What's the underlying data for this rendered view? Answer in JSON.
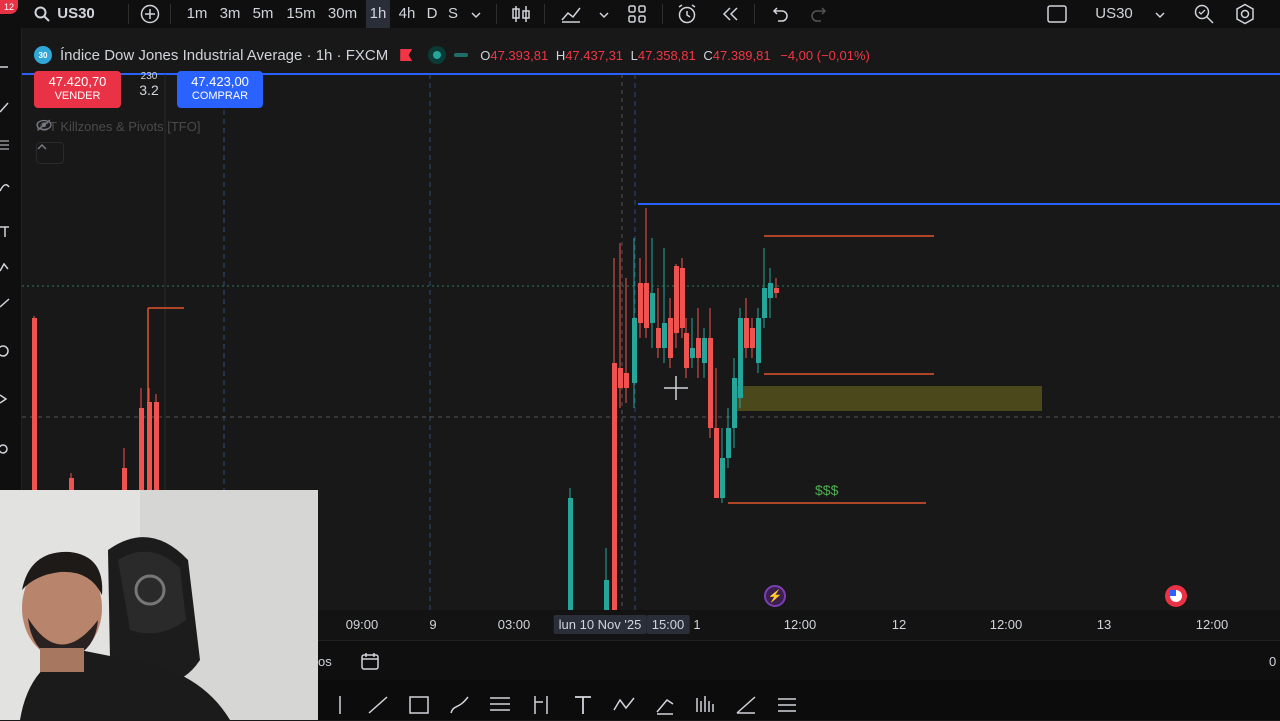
{
  "toolbar": {
    "symbol": "US30",
    "timeframes": [
      "1m",
      "3m",
      "5m",
      "15m",
      "30m",
      "1h",
      "4h",
      "D",
      "S"
    ],
    "active_timeframe": "1h",
    "right_symbol": "US30",
    "notification_count": "12"
  },
  "legend": {
    "symbol_badge": "30",
    "title": "Índice Dow Jones Industrial Average · 1h · FXCM",
    "open_label": "O",
    "open": "47.393,81",
    "high_label": "H",
    "high": "47.437,31",
    "low_label": "L",
    "low": "47.358,81",
    "close_label": "C",
    "close": "47.389,81",
    "change": "−4,00 (−0,01%)"
  },
  "trade": {
    "sell_price": "47.420,70",
    "sell_label": "VENDER",
    "buy_price": "47.423,00",
    "buy_label": "COMPRAR",
    "spread": "3.2",
    "spread_top": "230"
  },
  "indicator": {
    "name": "ICT Killzones & Pivots [TFO]"
  },
  "annotations": {
    "liquidity_label": "$$$"
  },
  "time_axis": {
    "labels": [
      "09:00",
      "9",
      "03:00",
      "lun 10 Nov '25",
      "15:00",
      "1",
      "12:00",
      "12",
      "12:00",
      "13",
      "12:00"
    ]
  },
  "bottom": {
    "left_text": "os",
    "right_text": "0"
  },
  "colors": {
    "up": "#26a69a",
    "down": "#ef5350",
    "accent_blue": "#2962ff",
    "sell": "#e93246",
    "zone": "#5c5a1e",
    "liquidity_text": "#4caf50"
  },
  "icons": [
    "search-icon",
    "add-icon",
    "candles-icon",
    "indicators-icon",
    "layout-icon",
    "alert-icon",
    "replay-icon",
    "undo-icon",
    "redo-icon",
    "fullscreen-icon",
    "chevron-down-icon",
    "quick-search-icon",
    "settings-icon"
  ]
}
